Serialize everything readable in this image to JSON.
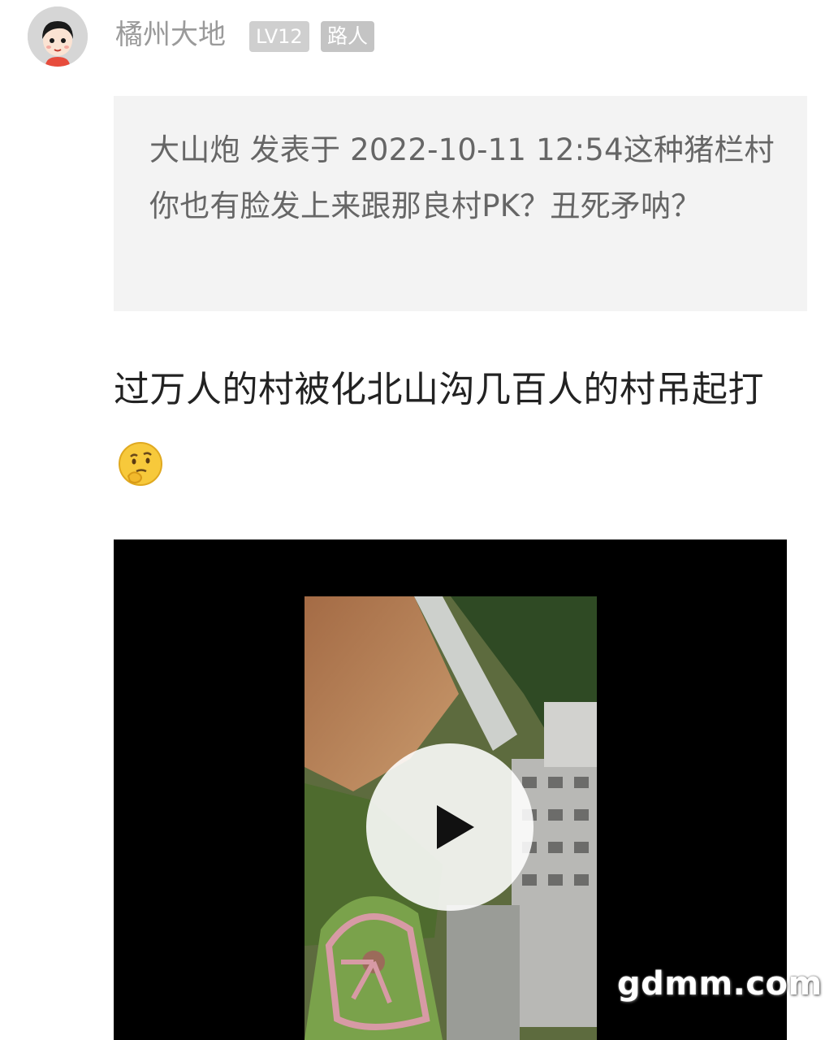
{
  "user": {
    "name": "橘州大地",
    "level": "LV12",
    "role": "路人"
  },
  "quote": {
    "text": "大山炮 发表于 2022-10-11 12:54这种猪栏村你也有脸发上来跟那良村PK？丑死矛呐？"
  },
  "post": {
    "text": "过万人的村被化北山沟几百人的村吊起打",
    "emoji": "thinking-face-icon"
  },
  "video": {
    "play_icon": "play-icon"
  },
  "watermark": "gdmm.com"
}
